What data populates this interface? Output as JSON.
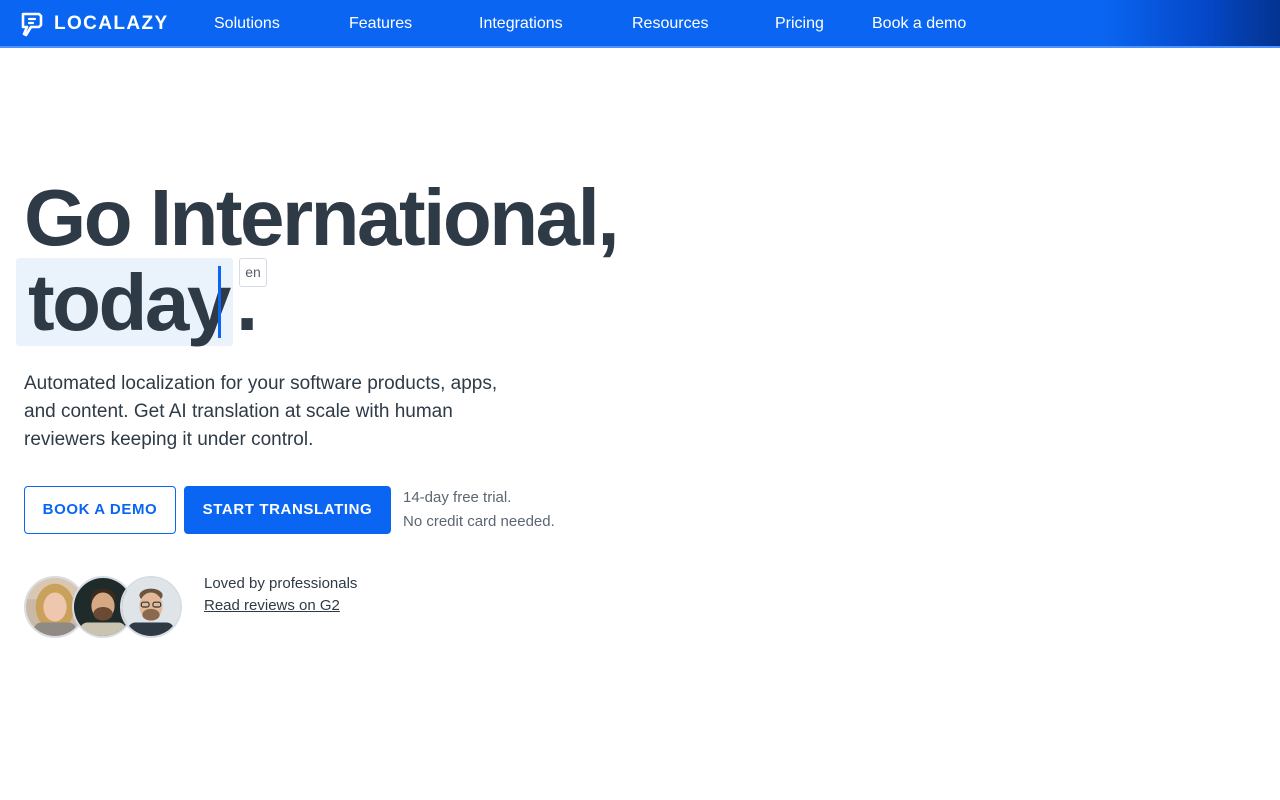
{
  "brand": {
    "name": "LOCALAZY",
    "logo_icon": "localazy-logo-icon",
    "primary_color": "#0a66f2",
    "text_color": "#2f3a47"
  },
  "nav": {
    "items": [
      {
        "label": "Solutions"
      },
      {
        "label": "Features"
      },
      {
        "label": "Integrations"
      },
      {
        "label": "Resources"
      },
      {
        "label": "Pricing"
      },
      {
        "label": "Book a demo"
      }
    ]
  },
  "hero": {
    "headline_line1": "Go International,",
    "typed_word": "today",
    "period": ".",
    "language_tag": "en",
    "subtitle": "Automated localization for your software products, apps, and content. Get AI translation at scale with human reviewers keeping it under control.",
    "buttons": {
      "demo_label": "BOOK A DEMO",
      "start_label": "START TRANSLATING"
    },
    "trial_line1": "14-day free trial.",
    "trial_line2": "No credit card needed."
  },
  "social_proof": {
    "avatars": [
      "avatar-woman",
      "avatar-man-beard",
      "avatar-man-glasses"
    ],
    "loved_text": "Loved by professionals",
    "reviews_link": "Read reviews on G2"
  }
}
